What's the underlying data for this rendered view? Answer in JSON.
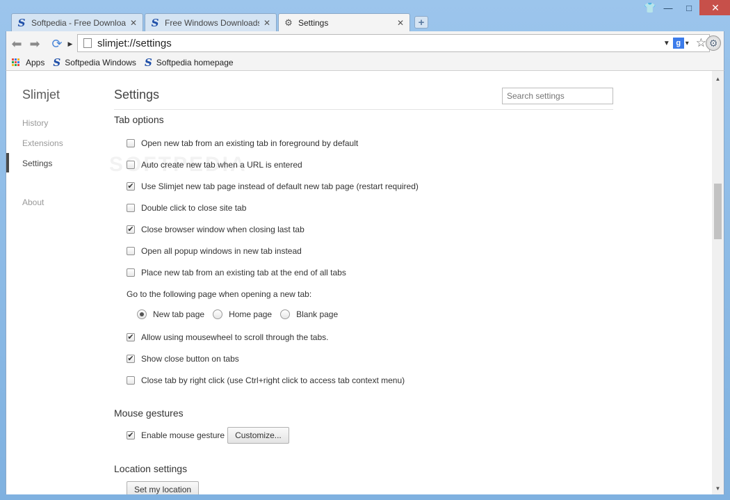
{
  "tabs": [
    {
      "title": "Softpedia - Free Downloads Encyclopedia",
      "icon": "softpedia-favicon"
    },
    {
      "title": "Free Windows Downloads - Softpedia",
      "icon": "softpedia-favicon"
    },
    {
      "title": "Settings",
      "icon": "settings-gear-favicon"
    }
  ],
  "address_bar": {
    "url": "slimjet://settings",
    "search_engine": "g"
  },
  "bookmarks": [
    {
      "label": "Apps",
      "icon": "apps-grid-icon"
    },
    {
      "label": "Softpedia Windows",
      "icon": "softpedia-favicon"
    },
    {
      "label": "Softpedia homepage",
      "icon": "softpedia-favicon"
    }
  ],
  "sidebar": {
    "brand": "Slimjet",
    "items": [
      {
        "label": "History"
      },
      {
        "label": "Extensions"
      },
      {
        "label": "Settings",
        "active": true
      },
      {
        "label": "About"
      }
    ]
  },
  "main": {
    "title": "Settings",
    "search_placeholder": "Search settings",
    "tab_options": {
      "heading": "Tab options",
      "checkboxes": [
        {
          "label": "Open new tab from an existing tab in foreground by default",
          "checked": false
        },
        {
          "label": "Auto create new tab when a URL is entered",
          "checked": false
        },
        {
          "label": "Use Slimjet new tab page instead of default new tab page (restart required)",
          "checked": true
        },
        {
          "label": "Double click to close site tab",
          "checked": false
        },
        {
          "label": "Close browser window when closing last tab",
          "checked": true
        },
        {
          "label": "Open all popup windows in new tab instead",
          "checked": false
        },
        {
          "label": "Place new tab from an existing tab at the end of all tabs",
          "checked": false
        }
      ],
      "new_tab_prompt": "Go to the following page when opening a new tab:",
      "new_tab_options": [
        {
          "label": "New tab page",
          "selected": true
        },
        {
          "label": "Home page",
          "selected": false
        },
        {
          "label": "Blank page",
          "selected": false
        }
      ],
      "checkboxes2": [
        {
          "label": "Allow using mousewheel to scroll through the tabs.",
          "checked": true
        },
        {
          "label": "Show close button on tabs",
          "checked": true
        },
        {
          "label": "Close tab by right click (use Ctrl+right click to access tab context menu)",
          "checked": false
        }
      ]
    },
    "mouse_gestures": {
      "heading": "Mouse gestures",
      "enable_label": "Enable mouse gesture",
      "enabled": true,
      "customize_label": "Customize..."
    },
    "location": {
      "heading": "Location settings",
      "button_label": "Set my location"
    }
  },
  "watermark": "SOFTPEDIA"
}
